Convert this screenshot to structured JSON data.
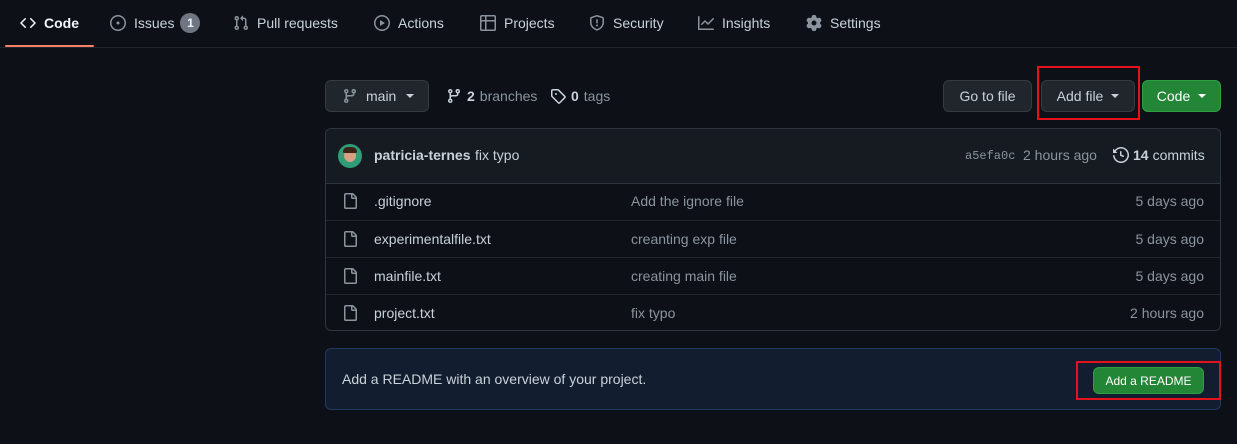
{
  "nav": {
    "tabs": [
      {
        "label": "Code",
        "icon": "code-icon",
        "selected": true
      },
      {
        "label": "Issues",
        "icon": "issue-opened-icon",
        "count": "1"
      },
      {
        "label": "Pull requests",
        "icon": "git-pull-request-icon"
      },
      {
        "label": "Actions",
        "icon": "play-icon"
      },
      {
        "label": "Projects",
        "icon": "table-icon"
      },
      {
        "label": "Security",
        "icon": "shield-icon"
      },
      {
        "label": "Insights",
        "icon": "graph-icon"
      },
      {
        "label": "Settings",
        "icon": "gear-icon"
      }
    ]
  },
  "toolbar": {
    "branch": "main",
    "branches_count": "2",
    "branches_label": "branches",
    "tags_count": "0",
    "tags_label": "tags",
    "go_to_file": "Go to file",
    "add_file": "Add file",
    "code": "Code"
  },
  "commit": {
    "author": "patricia-ternes",
    "message": "fix typo",
    "sha": "a5efa0c",
    "time": "2 hours ago",
    "count": "14",
    "count_label": "commits"
  },
  "files": [
    {
      "name": ".gitignore",
      "message": "Add the ignore file",
      "age": "5 days ago"
    },
    {
      "name": "experimentalfile.txt",
      "message": "creanting exp file",
      "age": "5 days ago"
    },
    {
      "name": "mainfile.txt",
      "message": "creating main file",
      "age": "5 days ago"
    },
    {
      "name": "project.txt",
      "message": "fix typo",
      "age": "2 hours ago"
    }
  ],
  "readme": {
    "text": "Add a README with an overview of your project.",
    "button": "Add a README"
  },
  "colors": {
    "background": "#0d1117",
    "accent_green": "#238636",
    "tab_underline": "#f78166",
    "highlight_box": "#e3121b"
  }
}
